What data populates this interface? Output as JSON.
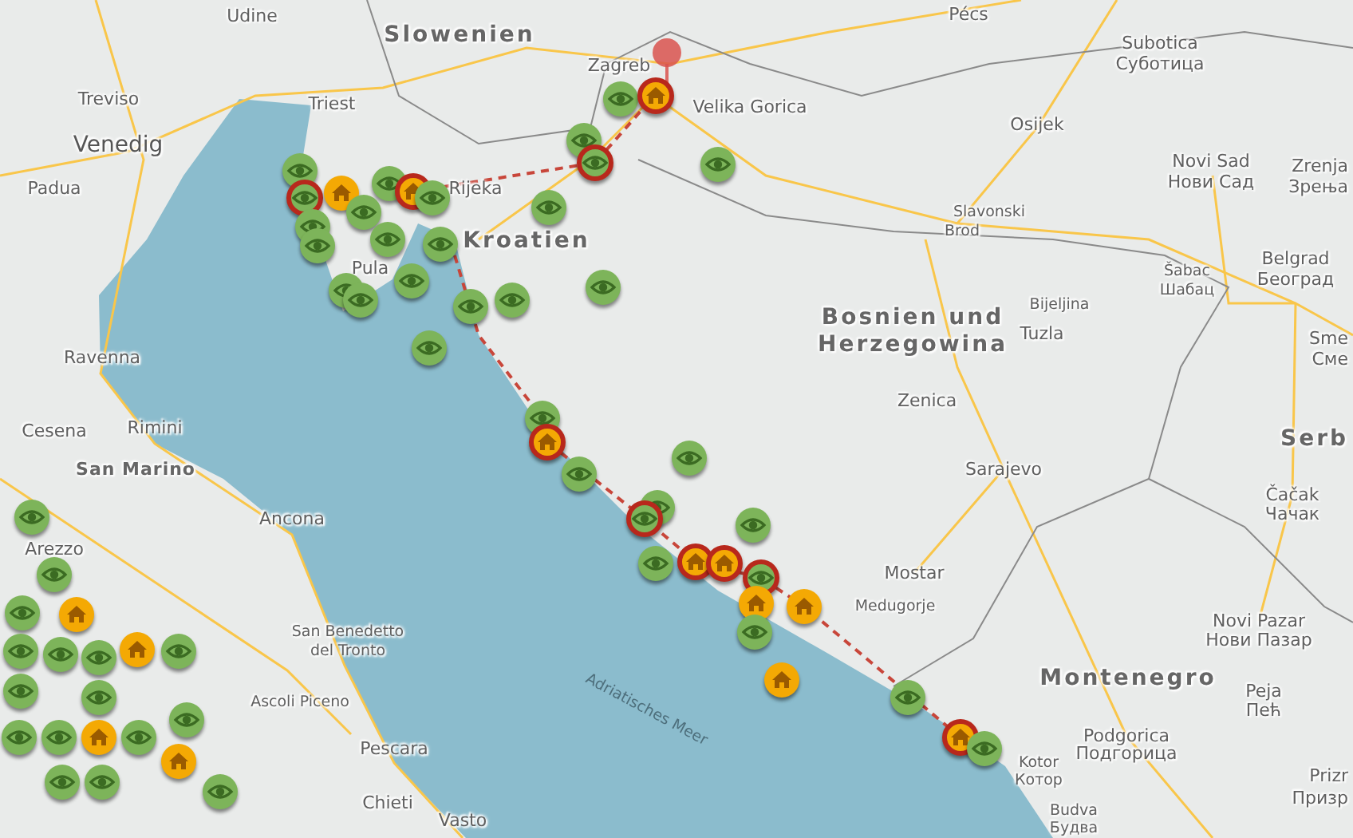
{
  "map": {
    "labels": [
      {
        "text": "Udine",
        "kind": "city"
      },
      {
        "text": "Slowenien",
        "kind": "country"
      },
      {
        "text": "Pécs",
        "kind": "city"
      },
      {
        "text": "Subotica",
        "kind": "city"
      },
      {
        "text": "Суботица",
        "kind": "city"
      },
      {
        "text": "Treviso",
        "kind": "city"
      },
      {
        "text": "Triest",
        "kind": "city"
      },
      {
        "text": "Zagreb",
        "kind": "city"
      },
      {
        "text": "Venedig",
        "kind": "major"
      },
      {
        "text": "Velika Gorica",
        "kind": "city"
      },
      {
        "text": "Osijek",
        "kind": "city"
      },
      {
        "text": "Novi Sad",
        "kind": "city"
      },
      {
        "text": "Zrenja",
        "kind": "city"
      },
      {
        "text": "Padua",
        "kind": "city"
      },
      {
        "text": "Rijeka",
        "kind": "city"
      },
      {
        "text": "Нови Сад",
        "kind": "city"
      },
      {
        "text": "Зрења",
        "kind": "city"
      },
      {
        "text": "Slavonski",
        "kind": "town"
      },
      {
        "text": "Brod",
        "kind": "town"
      },
      {
        "text": "Kroatien",
        "kind": "country"
      },
      {
        "text": "Pula",
        "kind": "city"
      },
      {
        "text": "Belgrad",
        "kind": "city"
      },
      {
        "text": "Београд",
        "kind": "city"
      },
      {
        "text": "Šabac",
        "kind": "town"
      },
      {
        "text": "Шабац",
        "kind": "town"
      },
      {
        "text": "Bijeljina",
        "kind": "town"
      },
      {
        "text": "Bosnien und",
        "kind": "country"
      },
      {
        "text": "Herzegowina",
        "kind": "country"
      },
      {
        "text": "Tuzla",
        "kind": "city"
      },
      {
        "text": "Sme",
        "kind": "city"
      },
      {
        "text": "Сме",
        "kind": "city"
      },
      {
        "text": "Ravenna",
        "kind": "city"
      },
      {
        "text": "Zenica",
        "kind": "city"
      },
      {
        "text": "Cesena",
        "kind": "city"
      },
      {
        "text": "Rimini",
        "kind": "city"
      },
      {
        "text": "Serb",
        "kind": "country"
      },
      {
        "text": "San Marino",
        "kind": "state"
      },
      {
        "text": "Sarajevo",
        "kind": "city"
      },
      {
        "text": "Ancona",
        "kind": "city"
      },
      {
        "text": "Čačak",
        "kind": "city"
      },
      {
        "text": "Чачак",
        "kind": "city"
      },
      {
        "text": "Arezzo",
        "kind": "city"
      },
      {
        "text": "Mostar",
        "kind": "city"
      },
      {
        "text": "Medugorje",
        "kind": "town"
      },
      {
        "text": "Novi Pazar",
        "kind": "city"
      },
      {
        "text": "Нови Пазар",
        "kind": "city"
      },
      {
        "text": "San Benedetto",
        "kind": "town"
      },
      {
        "text": "del Tronto",
        "kind": "town"
      },
      {
        "text": "Montenegro",
        "kind": "country"
      },
      {
        "text": "Ascoli Piceno",
        "kind": "town"
      },
      {
        "text": "Adriatisches Meer",
        "kind": "sea"
      },
      {
        "text": "Peja",
        "kind": "city"
      },
      {
        "text": "Пећ",
        "kind": "city"
      },
      {
        "text": "Pescara",
        "kind": "city"
      },
      {
        "text": "Podgorica",
        "kind": "city"
      },
      {
        "text": "Подгорица",
        "kind": "city"
      },
      {
        "text": "Kotor",
        "kind": "town"
      },
      {
        "text": "Котор",
        "kind": "town"
      },
      {
        "text": "Chieti",
        "kind": "city"
      },
      {
        "text": "Vasto",
        "kind": "city"
      },
      {
        "text": "Budva",
        "kind": "town"
      },
      {
        "text": "Будва",
        "kind": "town"
      },
      {
        "text": "Prizr",
        "kind": "city"
      },
      {
        "text": "Призр",
        "kind": "city"
      }
    ],
    "markers": [
      {
        "kind": "eye",
        "highlighted": false
      },
      {
        "kind": "house",
        "highlighted": true
      },
      {
        "kind": "eye",
        "highlighted": false
      },
      {
        "kind": "eye",
        "highlighted": true
      },
      {
        "kind": "eye",
        "highlighted": false
      },
      {
        "kind": "eye",
        "highlighted": false
      },
      {
        "kind": "eye",
        "highlighted": true
      },
      {
        "kind": "house",
        "highlighted": false
      },
      {
        "kind": "eye",
        "highlighted": false
      },
      {
        "kind": "house",
        "highlighted": true
      },
      {
        "kind": "eye",
        "highlighted": false
      },
      {
        "kind": "eye",
        "highlighted": false
      },
      {
        "kind": "eye",
        "highlighted": false
      },
      {
        "kind": "eye",
        "highlighted": false
      },
      {
        "kind": "eye",
        "highlighted": false
      },
      {
        "kind": "eye",
        "highlighted": false
      },
      {
        "kind": "eye",
        "highlighted": false
      },
      {
        "kind": "eye",
        "highlighted": false
      },
      {
        "kind": "eye",
        "highlighted": false
      },
      {
        "kind": "eye",
        "highlighted": false
      },
      {
        "kind": "eye",
        "highlighted": false
      },
      {
        "kind": "eye",
        "highlighted": false
      },
      {
        "kind": "eye",
        "highlighted": false
      },
      {
        "kind": "eye",
        "highlighted": false
      },
      {
        "kind": "eye",
        "highlighted": false
      },
      {
        "kind": "house",
        "highlighted": true
      },
      {
        "kind": "eye",
        "highlighted": false
      },
      {
        "kind": "eye",
        "highlighted": false
      },
      {
        "kind": "eye",
        "highlighted": false
      },
      {
        "kind": "eye",
        "highlighted": true
      },
      {
        "kind": "eye",
        "highlighted": false
      },
      {
        "kind": "eye",
        "highlighted": false
      },
      {
        "kind": "house",
        "highlighted": true
      },
      {
        "kind": "house",
        "highlighted": true
      },
      {
        "kind": "eye",
        "highlighted": true
      },
      {
        "kind": "house",
        "highlighted": false
      },
      {
        "kind": "house",
        "highlighted": false
      },
      {
        "kind": "eye",
        "highlighted": false
      },
      {
        "kind": "house",
        "highlighted": false
      },
      {
        "kind": "eye",
        "highlighted": false
      },
      {
        "kind": "house",
        "highlighted": true
      },
      {
        "kind": "eye",
        "highlighted": false
      },
      {
        "kind": "eye",
        "highlighted": false
      },
      {
        "kind": "eye",
        "highlighted": false
      },
      {
        "kind": "eye",
        "highlighted": false
      },
      {
        "kind": "house",
        "highlighted": false
      },
      {
        "kind": "eye",
        "highlighted": false
      },
      {
        "kind": "eye",
        "highlighted": false
      },
      {
        "kind": "eye",
        "highlighted": false
      },
      {
        "kind": "house",
        "highlighted": false
      },
      {
        "kind": "eye",
        "highlighted": false
      },
      {
        "kind": "eye",
        "highlighted": false
      },
      {
        "kind": "eye",
        "highlighted": false
      },
      {
        "kind": "eye",
        "highlighted": false
      },
      {
        "kind": "eye",
        "highlighted": false
      },
      {
        "kind": "house",
        "highlighted": false
      },
      {
        "kind": "eye",
        "highlighted": false
      },
      {
        "kind": "eye",
        "highlighted": false
      },
      {
        "kind": "house",
        "highlighted": false
      },
      {
        "kind": "eye",
        "highlighted": false
      },
      {
        "kind": "eye",
        "highlighted": false
      },
      {
        "kind": "eye",
        "highlighted": false
      }
    ]
  }
}
